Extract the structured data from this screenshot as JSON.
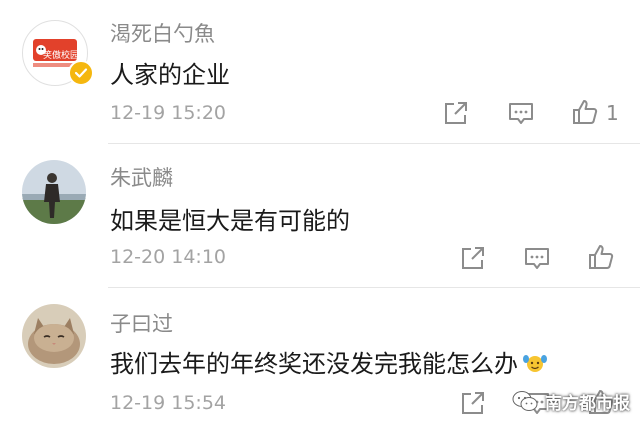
{
  "comments": [
    {
      "username": "渴死白勺魚",
      "avatar": "campus-logo-avatar",
      "avatar_text": "笑傲校园",
      "verified": true,
      "text": "人家的企业",
      "time": "12-19 15:20",
      "likes": "1"
    },
    {
      "username": "朱武麟",
      "avatar": "person-photo-avatar",
      "verified": false,
      "text": "如果是恒大是有可能的",
      "time": "12-20 14:10",
      "likes": ""
    },
    {
      "username": "子曰过",
      "avatar": "cat-photo-avatar",
      "verified": false,
      "text": "我们去年的年终奖还没发完我能怎么办",
      "emoji": "hands-up-emoji",
      "time": "12-19 15:54",
      "likes": ""
    }
  ],
  "icons": {
    "share": "share-icon",
    "comment": "comment-icon",
    "like": "thumbs-up-icon"
  },
  "watermark": {
    "text": "南方都市报",
    "logo": "wechat-logo-icon"
  },
  "colors": {
    "username": "#8a8a8a",
    "text": "#1a1a1a",
    "time": "#a3a3a3",
    "icon": "#8c8c8c",
    "verified": "#f5b70f"
  }
}
